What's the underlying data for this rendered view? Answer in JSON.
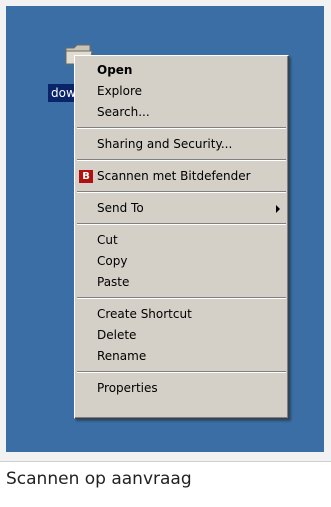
{
  "desktop": {
    "icon_label": "dow",
    "background_color": "#3a6ea5"
  },
  "menu": {
    "group1": [
      {
        "label": "Open",
        "bold": true
      },
      {
        "label": "Explore"
      },
      {
        "label": "Search..."
      }
    ],
    "group2": [
      {
        "label": "Sharing and Security..."
      }
    ],
    "group3": [
      {
        "label": "Scannen met Bitdefender",
        "icon": "bitdefender-icon",
        "icon_text": "B"
      }
    ],
    "group4": [
      {
        "label": "Send To",
        "submenu": true
      }
    ],
    "group5": [
      {
        "label": "Cut"
      },
      {
        "label": "Copy"
      },
      {
        "label": "Paste"
      }
    ],
    "group6": [
      {
        "label": "Create Shortcut"
      },
      {
        "label": "Delete"
      },
      {
        "label": "Rename"
      }
    ],
    "group7": [
      {
        "label": "Properties"
      }
    ]
  },
  "caption": "Scannen op aanvraag"
}
